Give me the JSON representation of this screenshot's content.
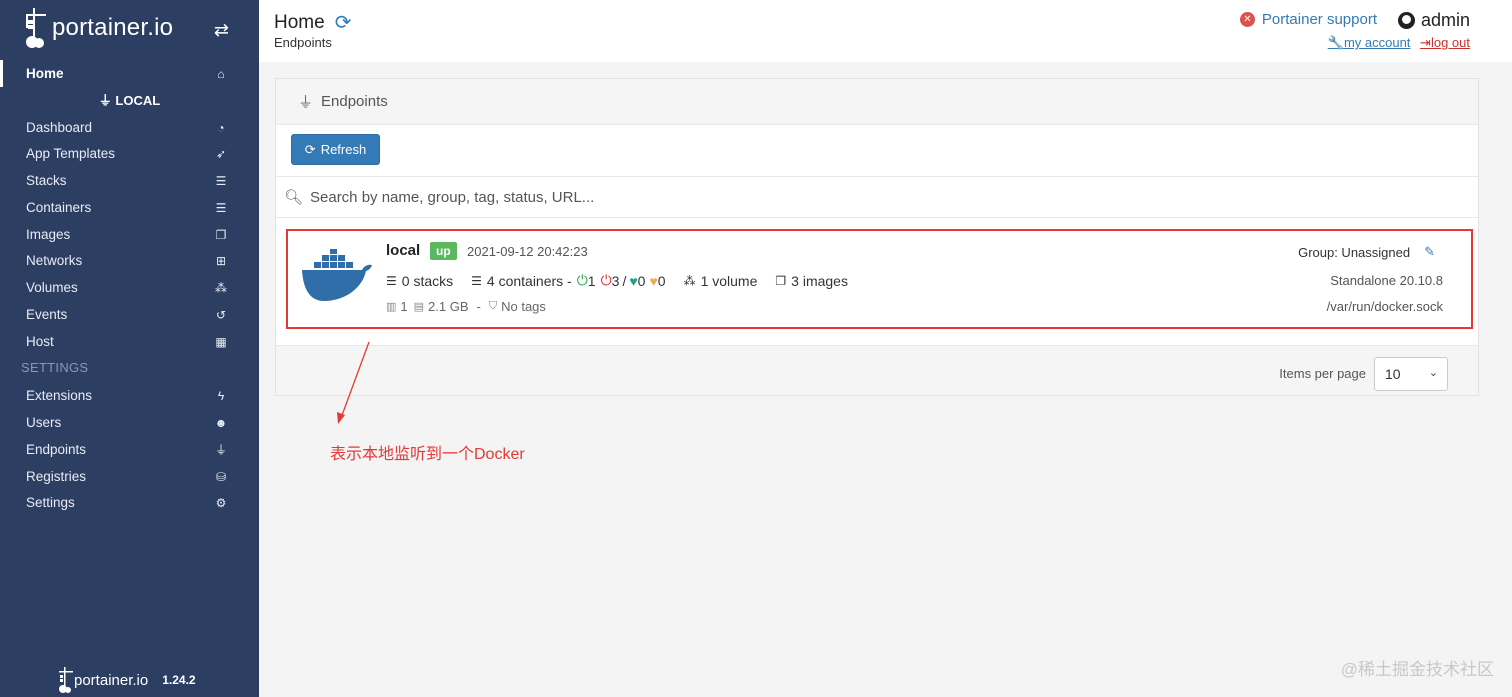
{
  "sidebar": {
    "brand": "portainer.io",
    "endpoint_name": "LOCAL",
    "items": [
      {
        "label": "Home",
        "icon": "home-icon",
        "glyph": "⌂"
      },
      {
        "label": "Dashboard",
        "icon": "tachometer-icon",
        "glyph": "◔"
      },
      {
        "label": "App Templates",
        "icon": "rocket-icon",
        "glyph": "➶"
      },
      {
        "label": "Stacks",
        "icon": "th-list-icon",
        "glyph": "☰"
      },
      {
        "label": "Containers",
        "icon": "server-icon",
        "glyph": "☰"
      },
      {
        "label": "Images",
        "icon": "clone-icon",
        "glyph": "❐"
      },
      {
        "label": "Networks",
        "icon": "sitemap-icon",
        "glyph": "⊞"
      },
      {
        "label": "Volumes",
        "icon": "cubes-icon",
        "glyph": "⁂"
      },
      {
        "label": "Events",
        "icon": "history-icon",
        "glyph": "↺"
      },
      {
        "label": "Host",
        "icon": "th-icon",
        "glyph": "▦"
      }
    ],
    "settings_section": "SETTINGS",
    "settings_items": [
      {
        "label": "Extensions",
        "icon": "bolt-icon",
        "glyph": "ϟ"
      },
      {
        "label": "Users",
        "icon": "users-icon",
        "glyph": "☻"
      },
      {
        "label": "Endpoints",
        "icon": "plug-icon",
        "glyph": "⏚"
      },
      {
        "label": "Registries",
        "icon": "database-icon",
        "glyph": "⛁"
      },
      {
        "label": "Settings",
        "icon": "cogs-icon",
        "glyph": "⚙"
      }
    ],
    "footer_brand": "portainer.io",
    "version": "1.24.2"
  },
  "header": {
    "title": "Home",
    "breadcrumb": "Endpoints",
    "support": "Portainer support",
    "username": "admin",
    "my_account": "my account",
    "log_out": "log out"
  },
  "panel": {
    "heading": "Endpoints",
    "refresh_button": "Refresh",
    "search_placeholder": "Search by name, group, tag, status, URL..."
  },
  "endpoint": {
    "name": "local",
    "status": "up",
    "date": "2021-09-12 20:42:23",
    "stacks": "0 stacks",
    "containers": "4 containers -",
    "running": "1",
    "stopped": "3",
    "slash": "/",
    "healthy": "0",
    "unhealthy": "0",
    "volumes": "1 volume",
    "images": "3 images",
    "cpu": "1",
    "memory": "2.1 GB",
    "dash": "-",
    "tags": "No tags",
    "group": "Group: Unassigned",
    "version": "Standalone 20.10.8",
    "url": "/var/run/docker.sock"
  },
  "pagination": {
    "label": "Items per page",
    "value": "10"
  },
  "annotation": "表示本地监听到一个Docker",
  "watermark": "@稀土掘金技术社区",
  "colors": {
    "sidebar": "#2d3e63",
    "primary": "#337ab7",
    "status_up": "#5cb85c",
    "annotation": "#e53935"
  }
}
